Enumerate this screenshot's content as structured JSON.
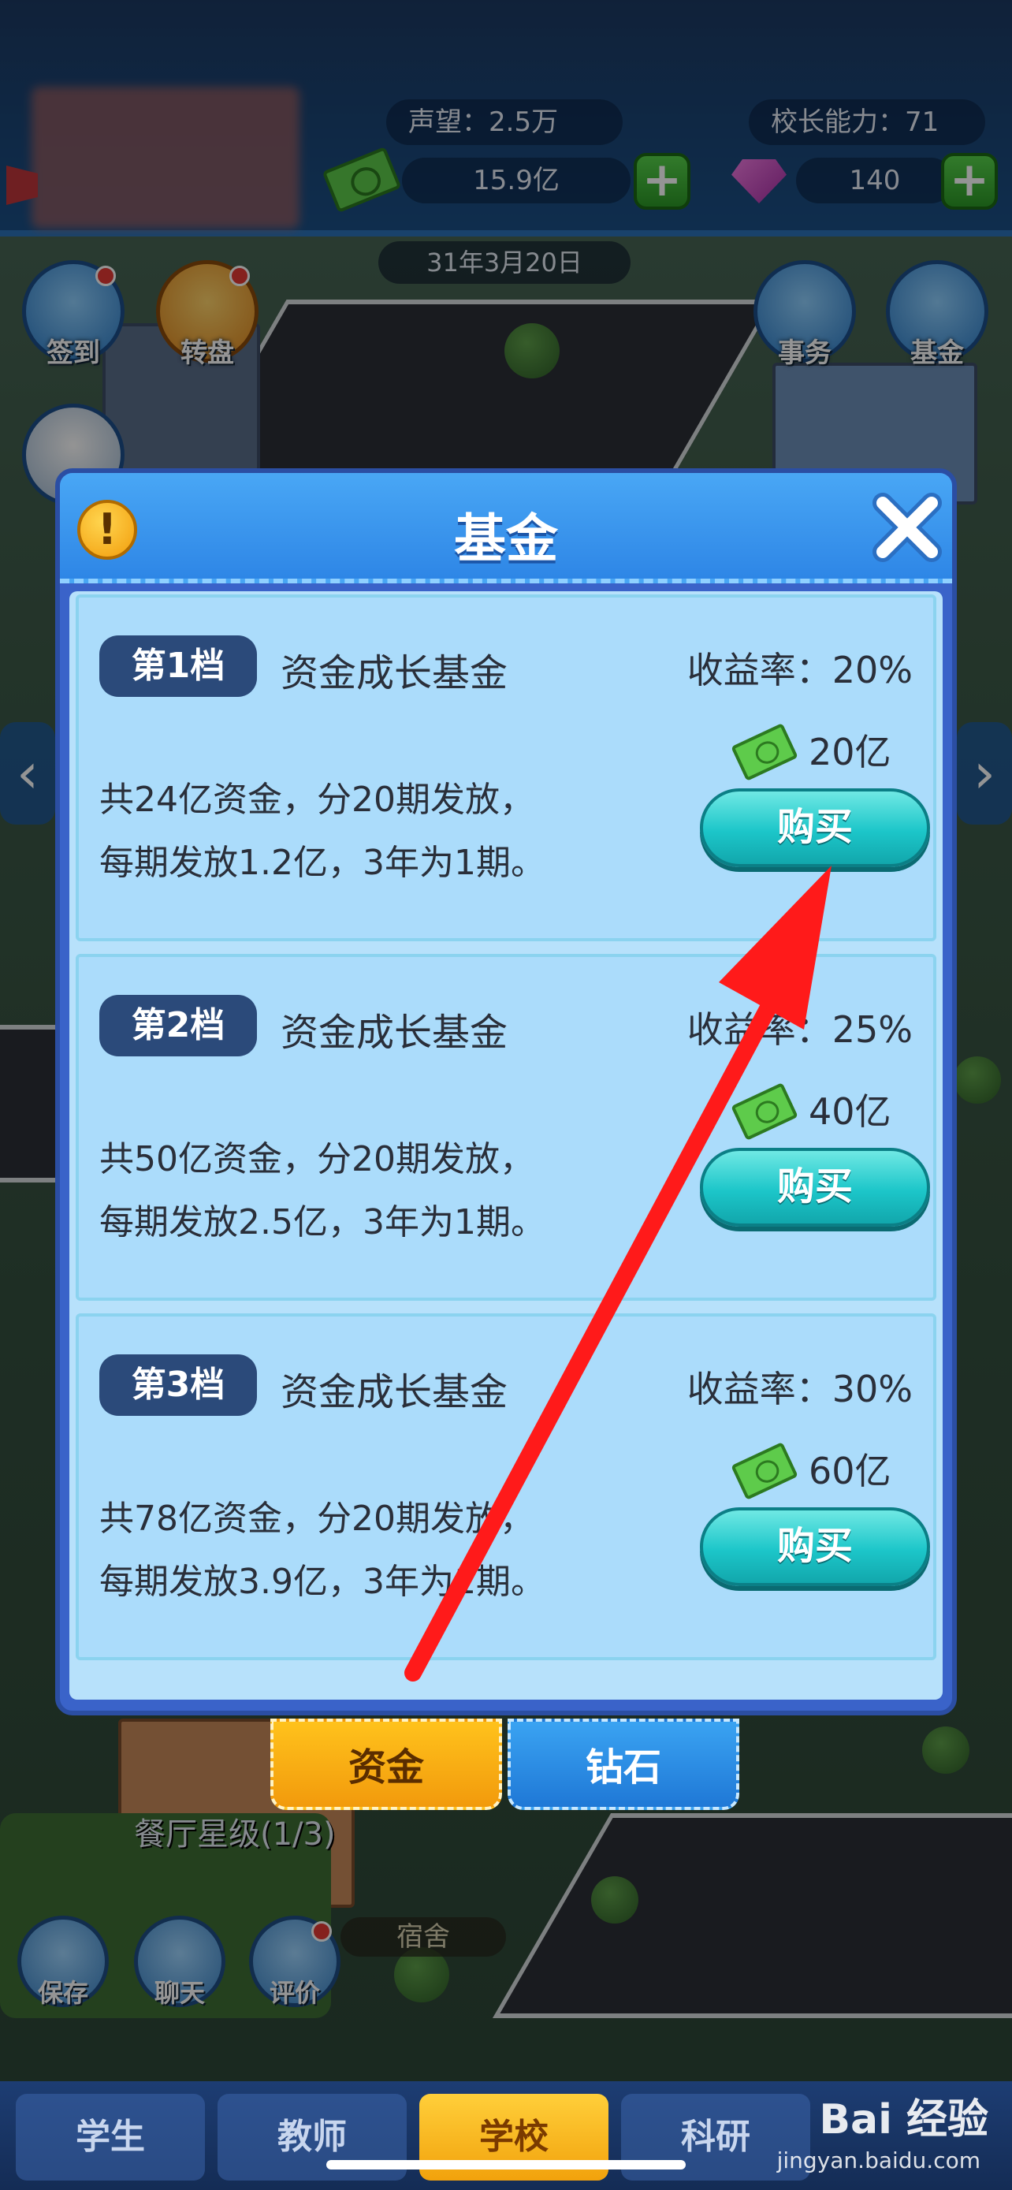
{
  "header": {
    "reputation_label": "声望：",
    "reputation_value": "2.5万",
    "principal_label": "校长能力：",
    "principal_value": "71",
    "cash_value": "15.9亿",
    "gems_value": "140",
    "date": "31年3月20日"
  },
  "side_buttons_left": [
    {
      "label": "签到"
    },
    {
      "label": "转盘"
    }
  ],
  "side_buttons_right": [
    {
      "label": "事务"
    },
    {
      "label": "基金"
    }
  ],
  "modal": {
    "title": "基金",
    "tiers": [
      {
        "badge": "第1档",
        "name": "资金成长基金",
        "yield": "收益率：20%",
        "desc_line1": "共24亿资金，分20期发放，",
        "desc_line2": "每期发放1.2亿，3年为1期。",
        "price": "20亿",
        "buy_label": "购买"
      },
      {
        "badge": "第2档",
        "name": "资金成长基金",
        "yield": "收益率：25%",
        "desc_line1": "共50亿资金，分20期发放，",
        "desc_line2": "每期发放2.5亿，3年为1期。",
        "price": "40亿",
        "buy_label": "购买"
      },
      {
        "badge": "第3档",
        "name": "资金成长基金",
        "yield": "收益率：30%",
        "desc_line1": "共78亿资金，分20期发放，",
        "desc_line2": "每期发放3.9亿，3年为1期。",
        "price": "60亿",
        "buy_label": "购买"
      }
    ],
    "tab_cash": "资金",
    "tab_gems": "钻石"
  },
  "background": {
    "restaurant_star": "餐厅星级(1/3)",
    "dorm_label": "宿舍",
    "quick_buttons": [
      {
        "label": "保存"
      },
      {
        "label": "聊天"
      },
      {
        "label": "评价"
      }
    ]
  },
  "bottom_nav": {
    "items": [
      {
        "label": "学生"
      },
      {
        "label": "教师"
      },
      {
        "label": "学校"
      },
      {
        "label": "科研"
      }
    ]
  },
  "watermark": {
    "brand": "Bai 经验",
    "url": "jingyan.baidu.com"
  },
  "colors": {
    "modal_blue": "#2e86e6",
    "buy_teal": "#1cc6c9",
    "tab_cash": "#f2a20c",
    "tab_gems": "#1f78d6",
    "arrow_red": "#ff1a1a"
  }
}
